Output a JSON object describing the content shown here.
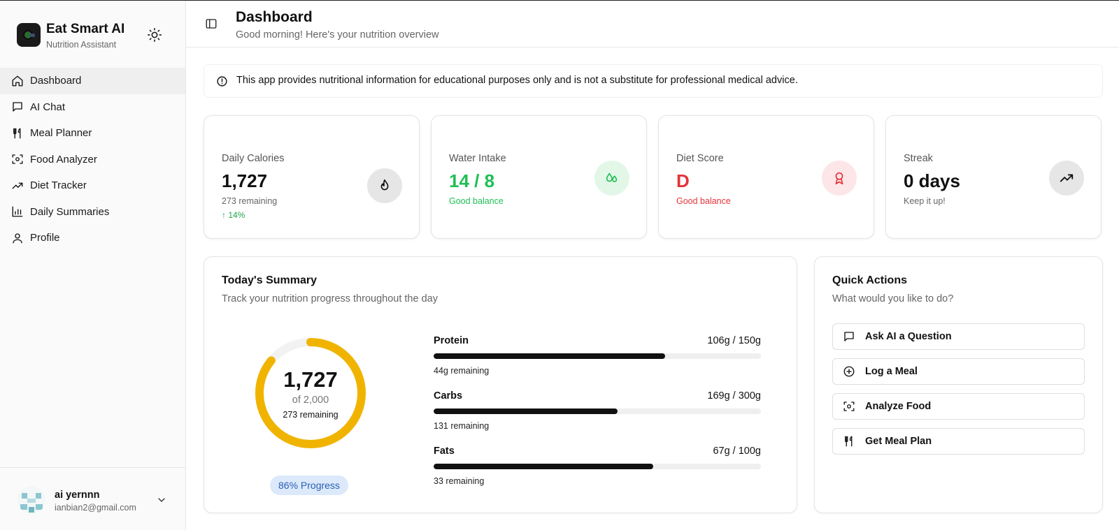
{
  "brand": {
    "name": "Eat Smart AI",
    "subtitle": "Nutrition Assistant"
  },
  "sidebar": {
    "items": [
      {
        "label": "Dashboard",
        "icon": "home-icon",
        "active": true
      },
      {
        "label": "AI Chat",
        "icon": "chat-icon"
      },
      {
        "label": "Meal Planner",
        "icon": "utensils-icon"
      },
      {
        "label": "Food Analyzer",
        "icon": "scan-icon"
      },
      {
        "label": "Diet Tracker",
        "icon": "trend-icon"
      },
      {
        "label": "Daily Summaries",
        "icon": "bar-chart-icon"
      },
      {
        "label": "Profile",
        "icon": "user-icon"
      }
    ]
  },
  "user": {
    "name": "ai yernnn",
    "email": "ianbian2@gmail.com"
  },
  "header": {
    "title": "Dashboard",
    "subtitle": "Good morning! Here's your nutrition overview"
  },
  "disclaimer": "This app provides nutritional information for educational purposes only and is not a substitute for professional medical advice.",
  "stats": [
    {
      "label": "Daily Calories",
      "value": "1,727",
      "sub": "273 remaining",
      "trend": "↑ 14%",
      "icon": "flame-icon"
    },
    {
      "label": "Water Intake",
      "value": "14 / 8",
      "sub": "Good balance",
      "icon": "droplets-icon"
    },
    {
      "label": "Diet Score",
      "value": "D",
      "sub": "Good balance",
      "icon": "award-icon"
    },
    {
      "label": "Streak",
      "value": "0 days",
      "sub": "Keep it up!",
      "icon": "trending-up-icon"
    }
  ],
  "summary": {
    "title": "Today's Summary",
    "description": "Track your nutrition progress throughout the day",
    "calories": "1,727",
    "of": "of 2,000",
    "remaining": "273 remaining",
    "progress_fraction": 0.86,
    "progress_label": "86% Progress",
    "macros": [
      {
        "name": "Protein",
        "amount": "106g / 150g",
        "remaining": "44g remaining",
        "fraction": 0.707
      },
      {
        "name": "Carbs",
        "amount": "169g / 300g",
        "remaining": "131 remaining",
        "fraction": 0.563
      },
      {
        "name": "Fats",
        "amount": "67g / 100g",
        "remaining": "33 remaining",
        "fraction": 0.67
      }
    ]
  },
  "quick_actions": {
    "title": "Quick Actions",
    "description": "What would you like to do?",
    "buttons": [
      {
        "label": "Ask AI a Question",
        "icon": "chat-icon"
      },
      {
        "label": "Log a Meal",
        "icon": "plus-circle-icon"
      },
      {
        "label": "Analyze Food",
        "icon": "scan-icon"
      },
      {
        "label": "Get Meal Plan",
        "icon": "utensils-icon"
      }
    ]
  },
  "colors": {
    "green": "#1fbf55",
    "red": "#e5333a",
    "ring": "#f0b400",
    "badge_bg": "#dbe9fb",
    "badge_text": "#2b5fb3"
  }
}
